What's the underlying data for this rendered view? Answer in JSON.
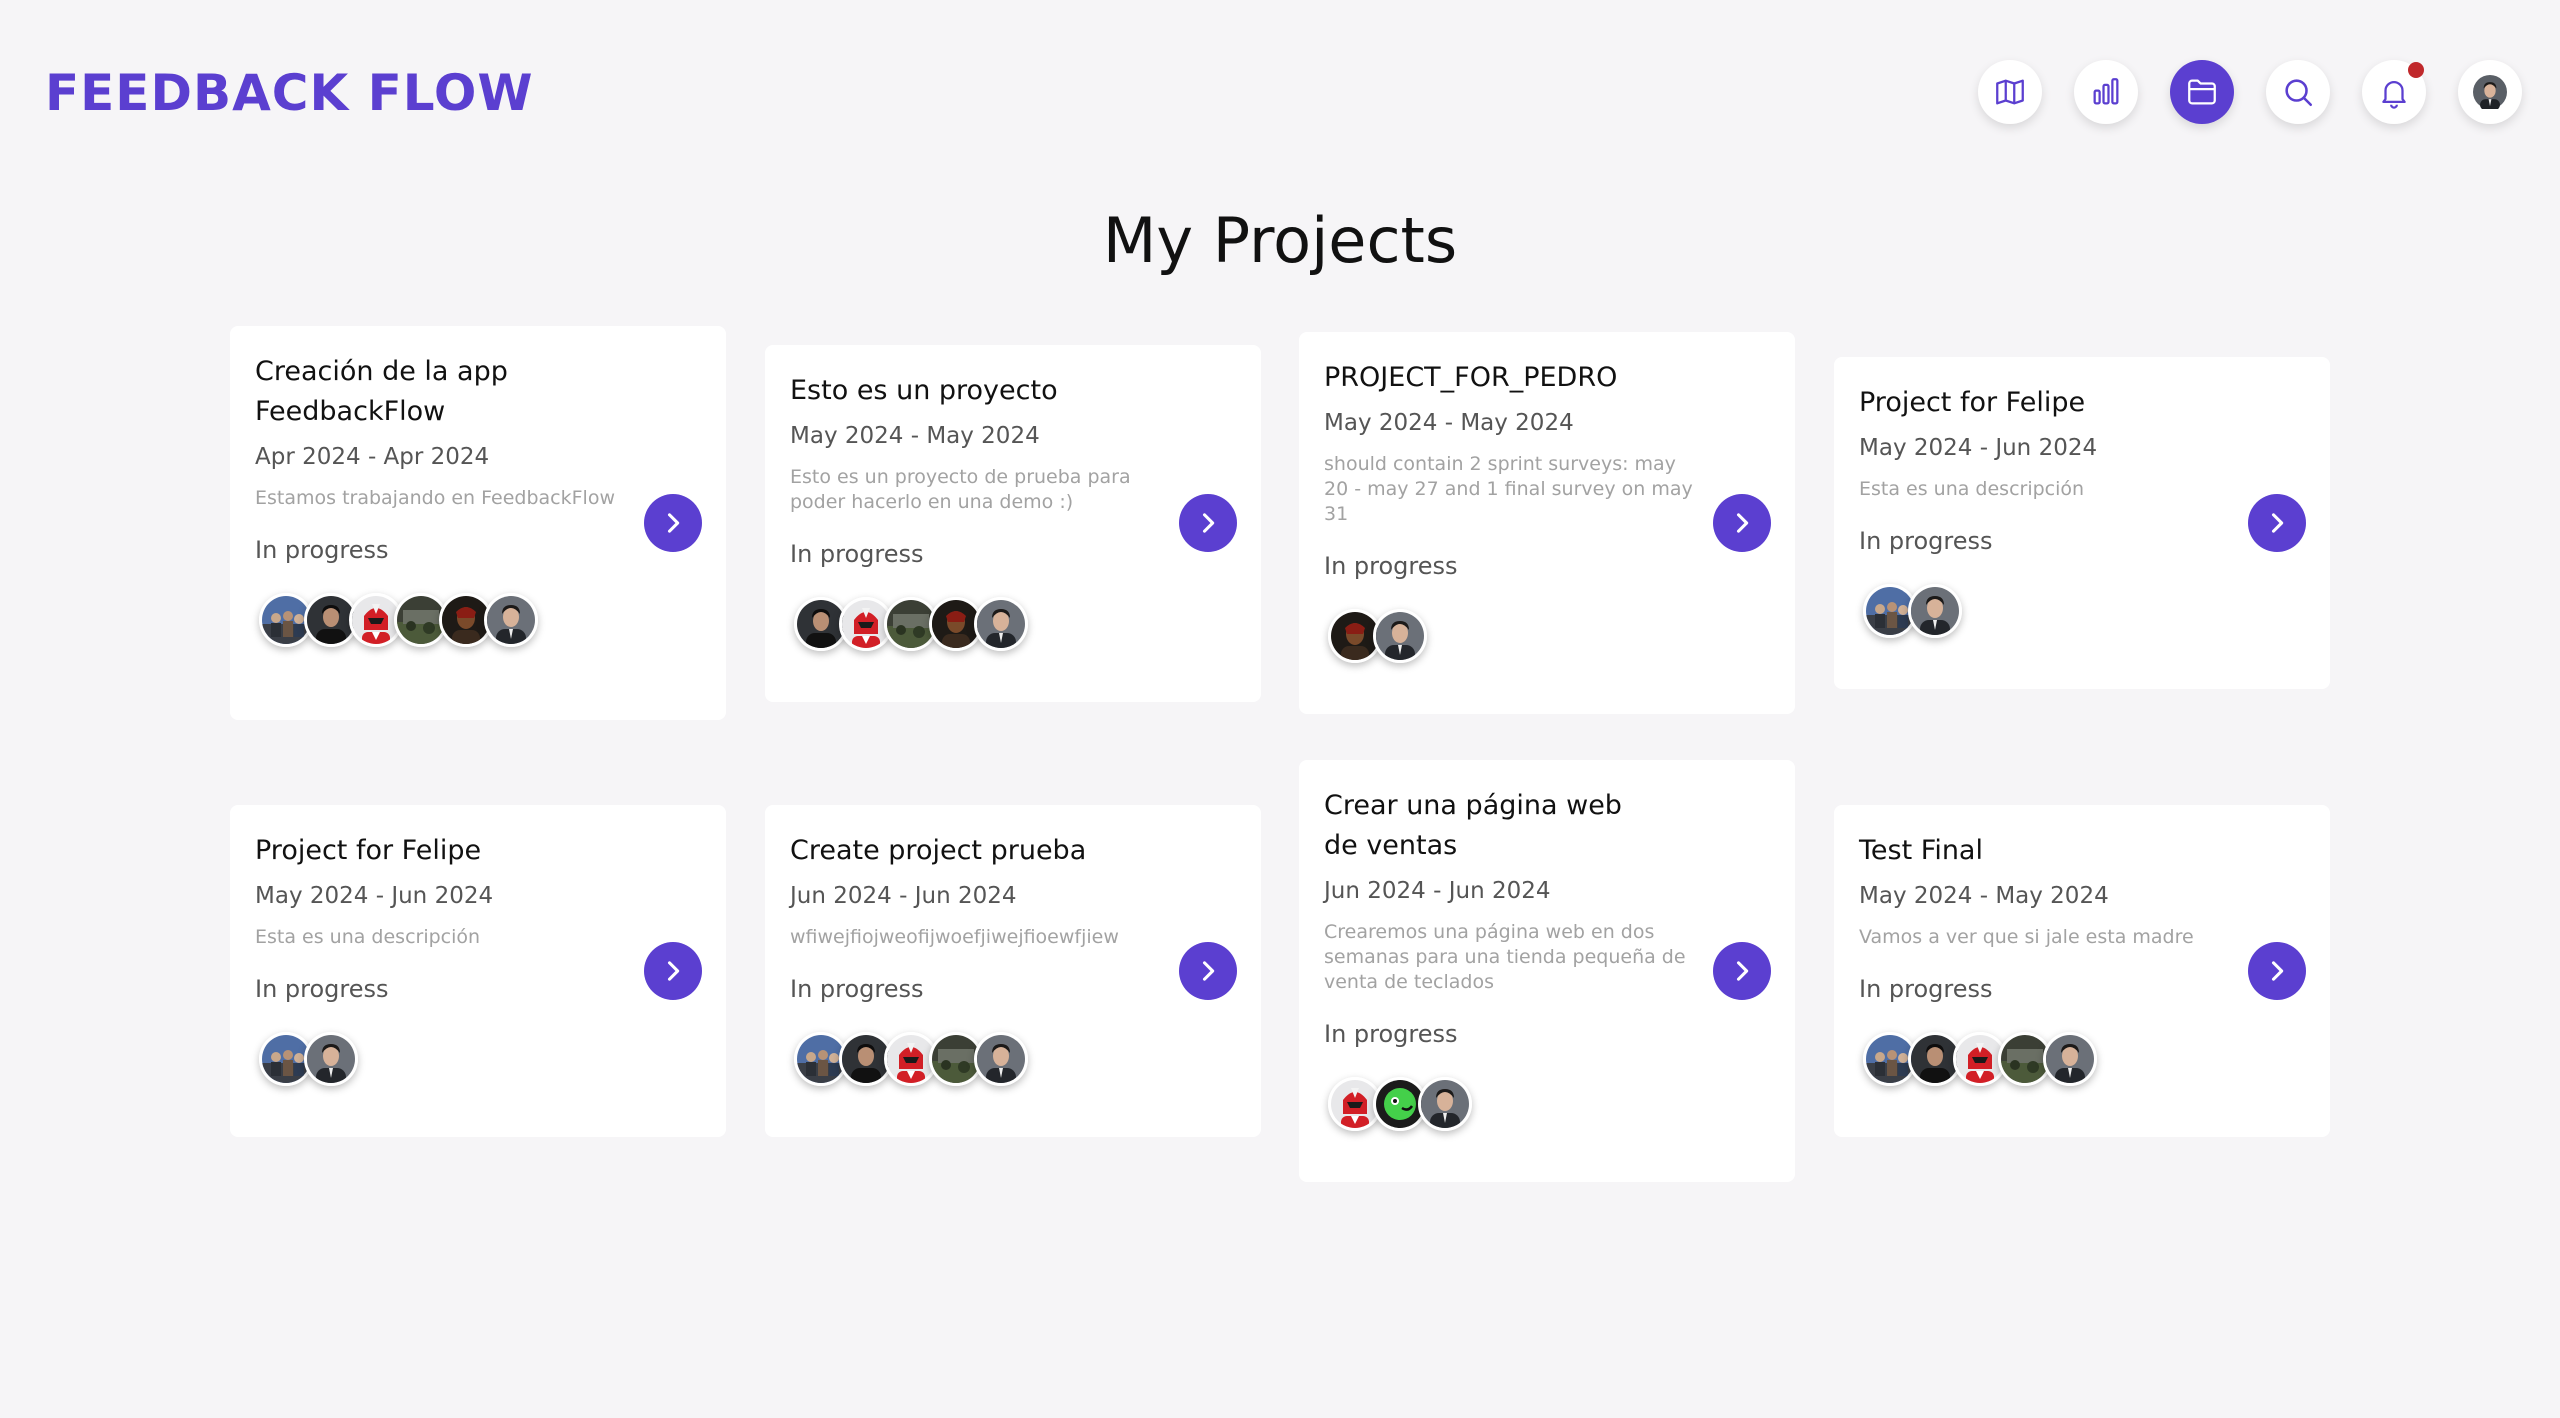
{
  "app": {
    "title": "FEEDBACK FLOW"
  },
  "colors": {
    "accent": "#5b3fd0",
    "notification": "#c0282b"
  },
  "nav": [
    {
      "name": "map-icon",
      "active": false
    },
    {
      "name": "bar-chart-icon",
      "active": false
    },
    {
      "name": "folder-icon",
      "active": true
    },
    {
      "name": "search-icon",
      "active": false
    },
    {
      "name": "bell-icon",
      "active": false,
      "badge": true
    },
    {
      "name": "user-avatar",
      "active": false
    }
  ],
  "page": {
    "title": "My Projects"
  },
  "projects": [
    {
      "title": "Creación de la app FeedbackFlow",
      "dates": "Apr 2024 - Apr 2024",
      "description": "Estamos trabajando en FeedbackFlow",
      "status": "In progress",
      "members": [
        "team-photo",
        "man-dark",
        "red-ranger",
        "garden-photo",
        "dark-warrior",
        "man-suit"
      ]
    },
    {
      "title": "Esto es un proyecto",
      "dates": "May 2024 - May 2024",
      "description": "Esto es un proyecto de prueba para poder hacerlo en una demo :)",
      "status": "In progress",
      "members": [
        "man-dark",
        "red-ranger",
        "garden-photo",
        "dark-warrior",
        "man-suit"
      ]
    },
    {
      "title": "PROJECT_FOR_PEDRO",
      "dates": "May 2024 - May 2024",
      "description": "should contain 2 sprint surveys: may 20 - may 27 and 1 final survey on may 31",
      "status": "In progress",
      "members": [
        "dark-warrior",
        "man-suit"
      ]
    },
    {
      "title": "Project for Felipe",
      "dates": "May 2024 - Jun 2024",
      "description": "Esta es una descripción",
      "status": "In progress",
      "members": [
        "team-photo",
        "man-suit"
      ]
    },
    {
      "title": "Project for Felipe",
      "dates": "May 2024 - Jun 2024",
      "description": "Esta es una descripción",
      "status": "In progress",
      "members": [
        "team-photo",
        "man-suit"
      ]
    },
    {
      "title": "Create project prueba",
      "dates": "Jun 2024 - Jun 2024",
      "description": "wfiwejfiojweofijwoefjiwejfioewfjiew",
      "status": "In progress",
      "members": [
        "team-photo",
        "man-dark",
        "red-ranger",
        "garden-photo",
        "man-suit"
      ]
    },
    {
      "title": "Crear una página web de ventas",
      "dates": "Jun 2024 - Jun 2024",
      "description": "Crearemos una página web en dos semanas para una tienda pequeña de venta de teclados",
      "status": "In progress",
      "members": [
        "red-ranger",
        "green-cartoon",
        "man-suit"
      ]
    },
    {
      "title": "Test Final",
      "dates": "May 2024 - May 2024",
      "description": "Vamos a ver que si jale esta madre",
      "status": "In progress",
      "members": [
        "team-photo",
        "man-dark",
        "red-ranger",
        "garden-photo",
        "man-suit"
      ]
    }
  ]
}
